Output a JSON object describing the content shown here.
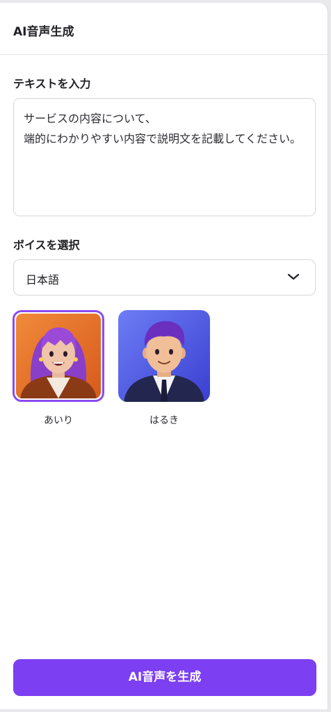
{
  "header": {
    "title": "AI音声生成"
  },
  "text_section": {
    "label": "テキストを入力",
    "value": "サービスの内容について、\n端的にわかりやすい内容で説明文を記載してください。"
  },
  "voice_section": {
    "label": "ボイスを選択",
    "language": "日本語",
    "voices": [
      {
        "name": "あいり",
        "selected": true
      },
      {
        "name": "はるき",
        "selected": false
      }
    ]
  },
  "actions": {
    "generate_label": "AI音声を生成"
  },
  "colors": {
    "accent": "#7c3ff2",
    "selected_border": "#8b4bf0"
  }
}
